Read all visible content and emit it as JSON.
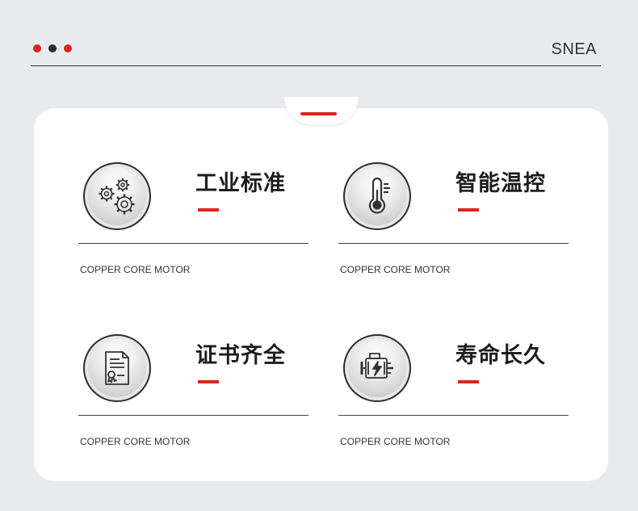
{
  "header": {
    "brand": "SNEA",
    "dot_colors": [
      "#e1221d",
      "#2b2b2b",
      "#e1221d"
    ]
  },
  "accent_color": "#e1221d",
  "features": [
    {
      "title": "工业标准",
      "subtitle": "COPPER CORE MOTOR",
      "icon": "gears-icon"
    },
    {
      "title": "智能温控",
      "subtitle": "COPPER CORE MOTOR",
      "icon": "thermometer-icon"
    },
    {
      "title": "证书齐全",
      "subtitle": "COPPER CORE MOTOR",
      "icon": "certificate-icon"
    },
    {
      "title": "寿命长久",
      "subtitle": "COPPER CORE MOTOR",
      "icon": "motor-icon"
    }
  ]
}
